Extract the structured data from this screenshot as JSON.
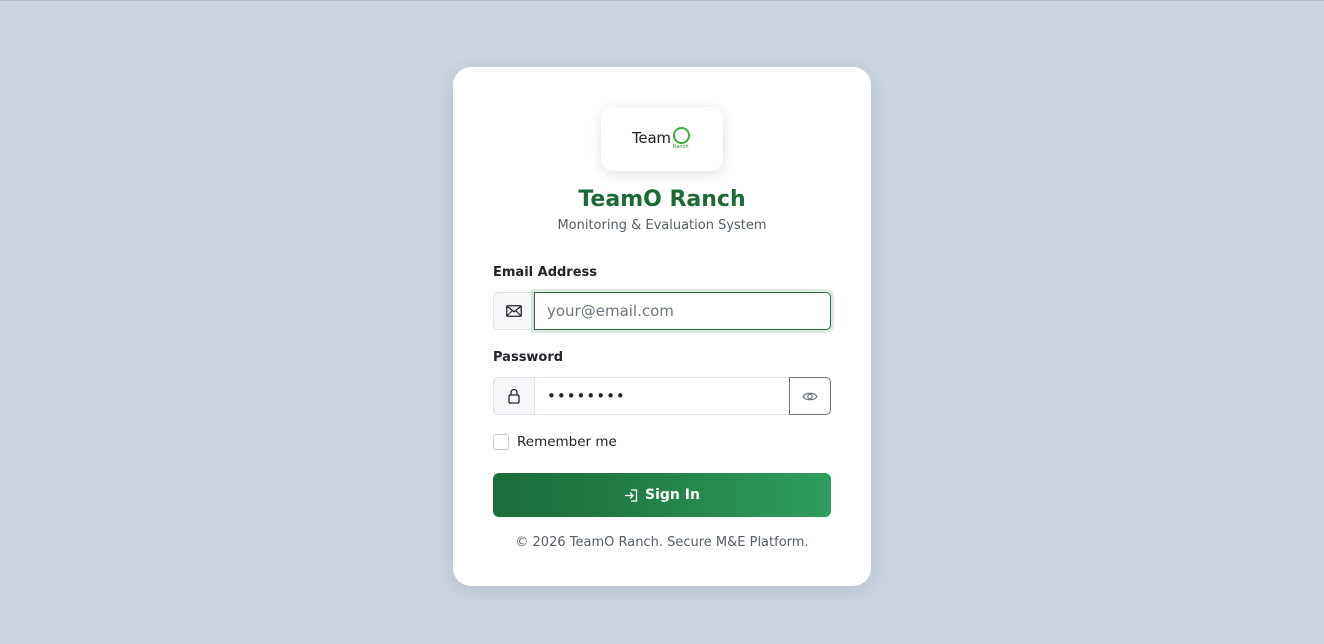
{
  "brand": {
    "logo_text": "Team",
    "logo_sub": "Ranch",
    "title": "TeamO Ranch",
    "subtitle": "Monitoring & Evaluation System"
  },
  "form": {
    "email_label": "Email Address",
    "email_placeholder": "your@email.com",
    "email_value": "",
    "password_label": "Password",
    "password_value": "••••••••",
    "remember_label": "Remember me",
    "remember_checked": false,
    "submit_label": "Sign In"
  },
  "footer": {
    "text": "© 2026 TeamO Ranch. Secure M&E Platform."
  },
  "icons": {
    "email": "envelope-icon",
    "password": "lock-icon",
    "toggle": "eye-icon",
    "submit": "sign-in-icon"
  },
  "colors": {
    "brand_green": "#1b6b38",
    "button_start": "#1b6e3d",
    "button_end": "#2e9e5e",
    "background": "#cbd5e1"
  }
}
